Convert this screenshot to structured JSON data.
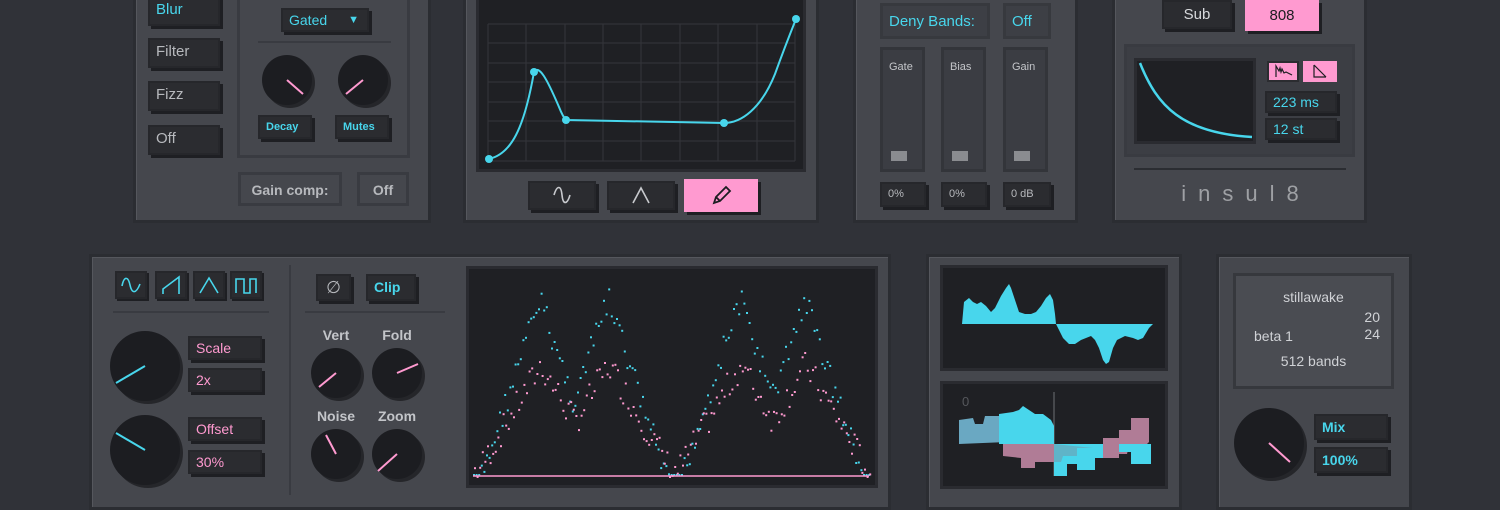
{
  "mode_list": {
    "items": [
      "Blur",
      "Filter",
      "Fizz",
      "Off"
    ]
  },
  "envelope_ctrl": {
    "mode": "Gated",
    "knob1_label": "Decay",
    "knob2_label": "Mutes",
    "gain_comp_label": "Gain comp:",
    "gain_comp_value": "Off"
  },
  "curve_editor": {
    "active_tool": "pencil"
  },
  "bands": {
    "deny_label": "Deny Bands:",
    "deny_value": "Off",
    "faders": [
      {
        "label": "Gate",
        "value": "0%"
      },
      {
        "label": "Bias",
        "value": "0%"
      },
      {
        "label": "Gain",
        "value": "0 dB"
      }
    ]
  },
  "drum": {
    "sub_label": "Sub",
    "active_label": "808",
    "time_value": "223 ms",
    "pitch_value": "12 st",
    "brand": "insul8"
  },
  "lfo": {
    "shapes": [
      "sine",
      "saw",
      "triangle",
      "square"
    ],
    "scale_label": "Scale",
    "scale_value": "2x",
    "offset_label": "Offset",
    "offset_value": "30%"
  },
  "fold": {
    "phase_symbol": "∅",
    "clip_label": "Clip",
    "knobs": [
      "Vert",
      "Fold",
      "Noise",
      "Zoom"
    ]
  },
  "scope": {
    "axis_zero": "0"
  },
  "info": {
    "author": "stillawake",
    "num1": "20",
    "version": "beta 1",
    "num2": "24",
    "bands": "512 bands",
    "mix_label": "Mix",
    "mix_value": "100%"
  },
  "colors": {
    "accent_cyan": "#48d6ec",
    "accent_pink": "#ff9ad0",
    "panel": "#45474d",
    "background": "#303238"
  }
}
